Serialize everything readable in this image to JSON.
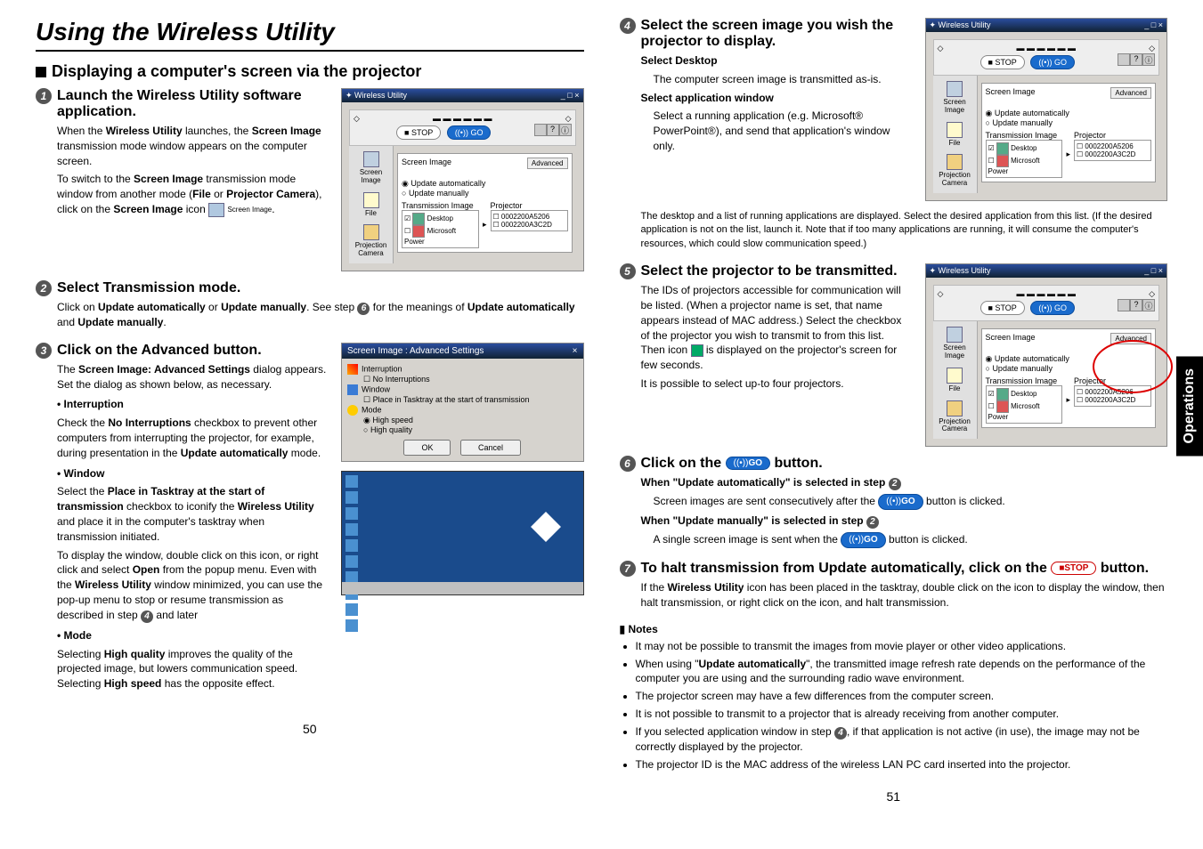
{
  "title": "Using the Wireless Utility",
  "section_heading": "Displaying a computer's screen via the projector",
  "left_page_num": "50",
  "right_page_num": "51",
  "side_tab": "Operations",
  "steps": {
    "s1": {
      "title": "Launch the Wireless Utility software application.",
      "p1a": "When the ",
      "p1b": "Wireless Utility",
      "p1c": " launches, the ",
      "p1d": "Screen Image",
      "p1e": " transmission mode window appears on the computer screen.",
      "p2a": "To switch to the ",
      "p2b": "Screen Image",
      "p2c": " transmission mode window from another mode (",
      "p2d": "File",
      "p2e": " or ",
      "p2f": "Projector Camera",
      "p2g": "), click on the ",
      "p2h": "Screen Image",
      "p2i": " icon ",
      "iconcap": "Screen Image",
      "p2j": "."
    },
    "s2": {
      "title": "Select Transmission mode.",
      "p1a": "Click on ",
      "p1b": "Update automatically",
      "p1c": " or ",
      "p1d": "Update manually",
      "p1e": ". See step ",
      "p1f": " for the meanings of ",
      "p1g": "Update automatically",
      "p1h": " and ",
      "p1i": "Update manually",
      "p1j": "."
    },
    "s3": {
      "title": "Click on the Advanced button.",
      "p1a": "The ",
      "p1b": "Screen Image: Advanced Settings",
      "p1c": " dialog appears. Set the dialog as shown below, as necessary.",
      "bul_int": "• Interruption",
      "int1a": "Check the ",
      "int1b": "No Interruptions",
      "int1c": " checkbox to prevent other computers from interrupting the projector, for example, during presentation in the ",
      "int1d": "Update automatically",
      "int1e": " mode.",
      "bul_win": "• Window",
      "win1a": "Select the ",
      "win1b": "Place in Tasktray at the start of transmission",
      "win1c": " checkbox to iconify the ",
      "win1d": "Wireless Utility",
      "win1e": " and place it in the computer's tasktray when transmission initiated.",
      "win2a": "To display the window, double click on this icon, or right click and select ",
      "win2b": "Open",
      "win2c": " from the popup menu. Even with the ",
      "win2d": "Wireless Utility",
      "win2e": " window minimized, you can use the pop-up menu to stop or resume transmission as described in step ",
      "win2f": " and later",
      "bul_mode": "• Mode",
      "mode1a": "Selecting ",
      "mode1b": "High quality",
      "mode1c": " improves the quality of the projected image, but lowers communication speed. Selecting ",
      "mode1d": "High speed",
      "mode1e": " has the opposite effect."
    },
    "s4": {
      "title": "Select the screen image you wish the projector to display.",
      "sub1": "Select Desktop",
      "sub1p": "The computer screen image is transmitted as-is.",
      "sub2": "Select application window",
      "sub2p": "Select a running application (e.g. Microsoft® PowerPoint®), and send that application's window only.",
      "note": "The desktop and a list of running applications are displayed. Select the desired application from this list. (If the desired application is not on the list, launch it. Note that if too many applications are running, it will consume the computer's resources, which could slow communication speed.)"
    },
    "s5": {
      "title": "Select the projector to be transmitted.",
      "p1": "The IDs of projectors accessible for communication will be listed. (When a projector name is set, that name appears instead of MAC address.) Select the checkbox of the projector you wish to transmit to from this list. Then icon ",
      "p2": " is displayed on the projector's screen for few seconds.",
      "p3": "It is possible to select up-to four projectors."
    },
    "s6": {
      "title_a": "Click on the ",
      "title_b": " button.",
      "l1a": "When \"Update automatically\" is selected in step ",
      "l1b": "Screen images are sent consecutively after the ",
      "l1c": " button is clicked.",
      "l2a": "When \"Update manually\" is selected in step ",
      "l2b": "A single screen image is sent when the ",
      "l2c": " button is clicked."
    },
    "s7": {
      "title_a": "To halt transmission from Update automatically, click on the ",
      "title_b": " button.",
      "p1a": "If the ",
      "p1b": "Wireless Utility",
      "p1c": " icon has been placed in the tasktray, double click on the icon to display the window, then halt transmission, or right click on the icon, and halt transmission."
    }
  },
  "notes_hdr": "Notes",
  "notes": [
    "It may not be possible to transmit the images from movie player or other video applications.",
    "When using \"Update automatically\", the transmitted image refresh rate depends on the performance of the computer you are using and the surrounding radio wave environment.",
    "The projector screen may have a few differences from the computer screen.",
    "It is not possible to transmit to a projector that is already receiving from another computer.",
    "If you selected application window in step 4, if that application is not active (in use), the image may not be correctly displayed by the projector.",
    "The projector ID is the MAC address of the wireless LAN PC card inserted into the projector."
  ],
  "ss": {
    "title": "Wireless Utility",
    "close": "×",
    "minmax": "_ □ ×",
    "stop": "STOP",
    "go": "GO",
    "heading_si": "Screen Image",
    "adv": "Advanced",
    "upd_auto": "Update automatically",
    "upd_man": "Update manually",
    "trans_img": "Transmission Image",
    "projector": "Projector",
    "desktop": "Desktop",
    "mspp": "Microsoft Power",
    "id1": "0002200A5206",
    "id2": "0002200A3C2D",
    "side_si": "Screen Image",
    "side_file": "File",
    "side_cam": "Projection Camera"
  },
  "dlg": {
    "title": "Screen Image : Advanced Settings",
    "sec_int": "Interruption",
    "int_chk": "No Interruptions",
    "sec_win": "Window",
    "win_chk": "Place in Tasktray at the start of transmission",
    "sec_mode": "Mode",
    "mode_hs": "High speed",
    "mode_hq": "High quality",
    "ok": "OK",
    "cancel": "Cancel"
  },
  "note4_prefix": "If you selected application window in step ",
  "note4_suffix": ", if that application is not active (in use), the image may not be correctly displayed by the projector."
}
